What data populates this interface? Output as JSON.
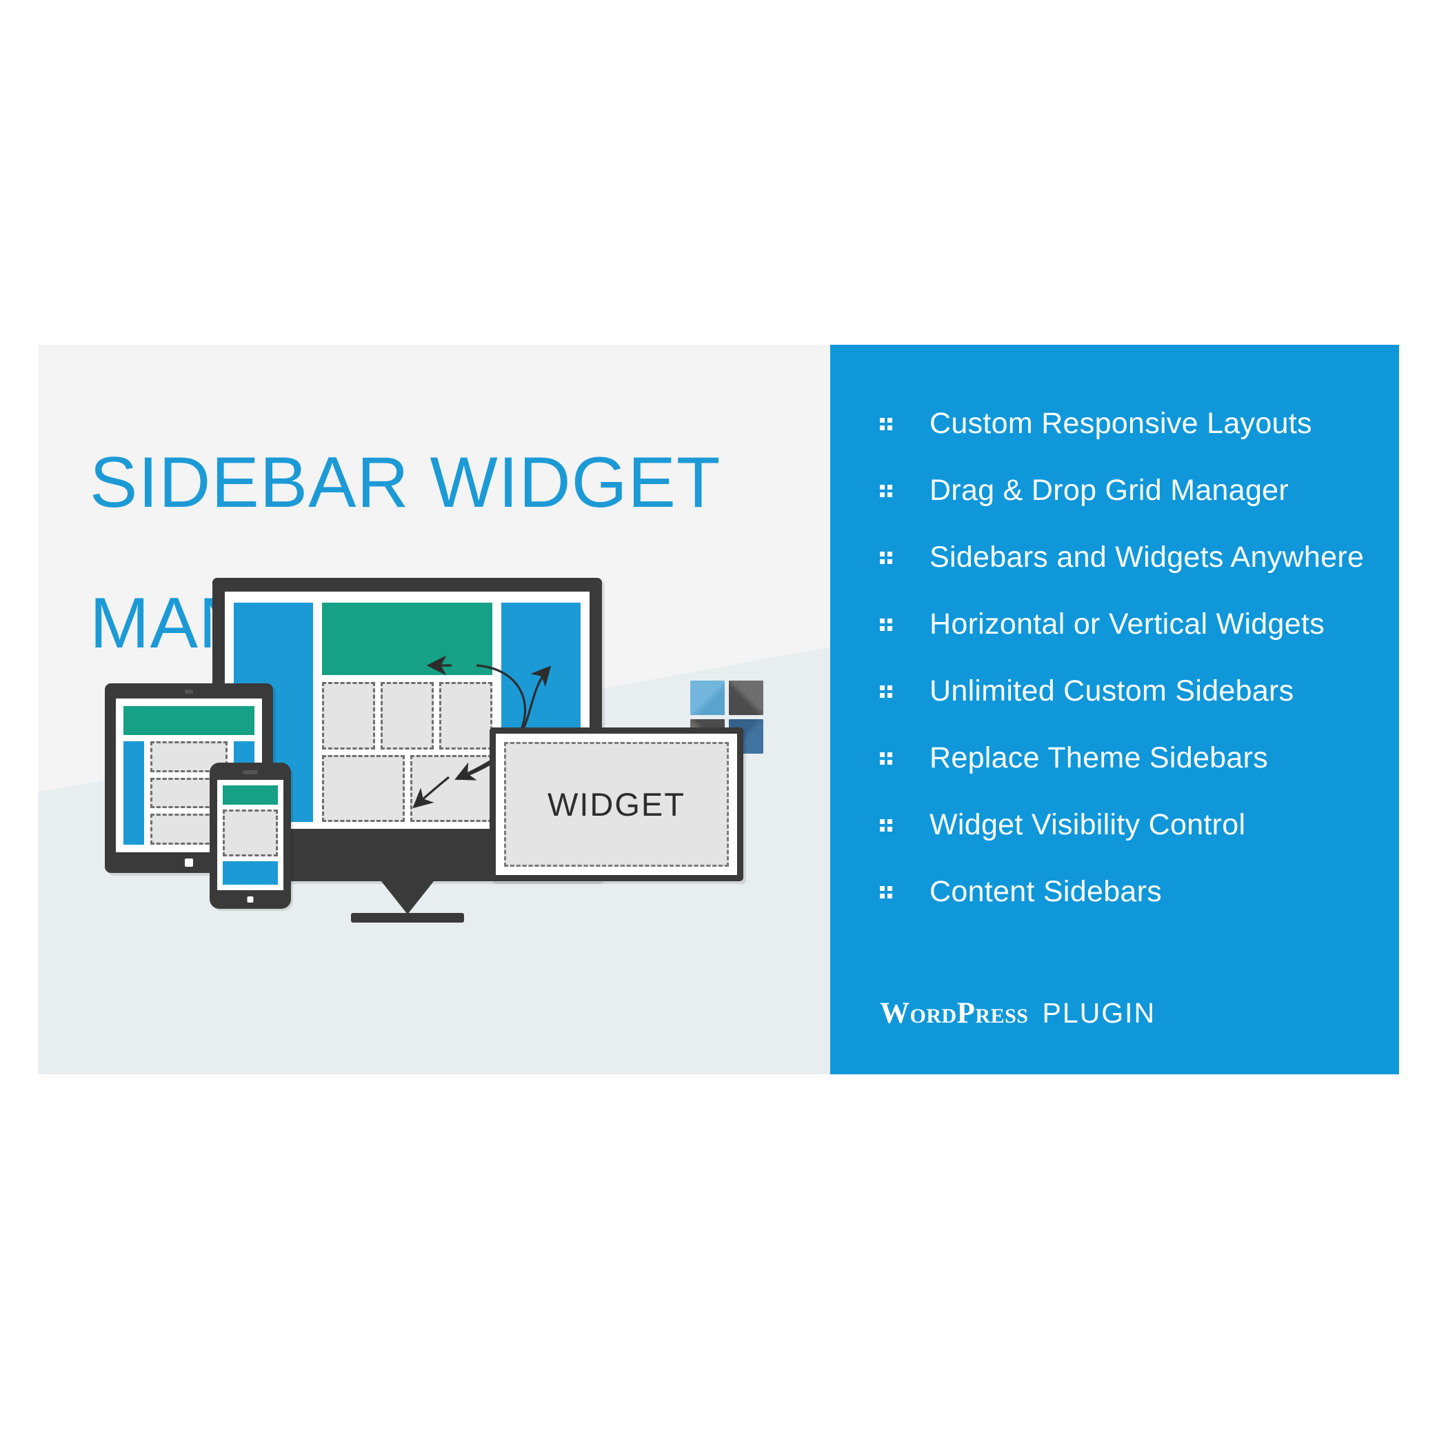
{
  "banner": {
    "title_line1": "SIDEBAR WIDGET",
    "title_line2": "MANAGER",
    "title_color": "#1c9ad6",
    "left_bg": "#f4f4f4",
    "left_bg_lower": "#e8eef0",
    "right_bg": "#0f97da"
  },
  "logo": {
    "name": "four-square-logo",
    "quadrants": [
      {
        "name": "top-left",
        "color": "#72b6dd"
      },
      {
        "name": "top-right",
        "color": "#4c4c4c"
      },
      {
        "name": "bottom-left",
        "color": "#4c4c4c"
      },
      {
        "name": "bottom-right",
        "color": "#35618a"
      }
    ]
  },
  "illustration": {
    "widget_card_label": "WIDGET",
    "device_colors": {
      "frame": "#3a3a3a",
      "sidebar_blue": "#1c9ad6",
      "header_green": "#16a085",
      "widget_fill": "#e4e4e4",
      "widget_dash": "#6e6e6e"
    },
    "devices": [
      "desktop-monitor",
      "tablet",
      "phone",
      "widget-card"
    ]
  },
  "features": [
    {
      "label": "Custom Responsive Layouts"
    },
    {
      "label": "Drag & Drop Grid Manager"
    },
    {
      "label": "Sidebars and Widgets Anywhere"
    },
    {
      "label": "Horizontal or Vertical Widgets"
    },
    {
      "label": "Unlimited Custom Sidebars"
    },
    {
      "label": "Replace Theme Sidebars"
    },
    {
      "label": "Widget Visibility Control"
    },
    {
      "label": "Content Sidebars"
    }
  ],
  "footer": {
    "product": "WordPress",
    "kind": "PLUGIN"
  }
}
